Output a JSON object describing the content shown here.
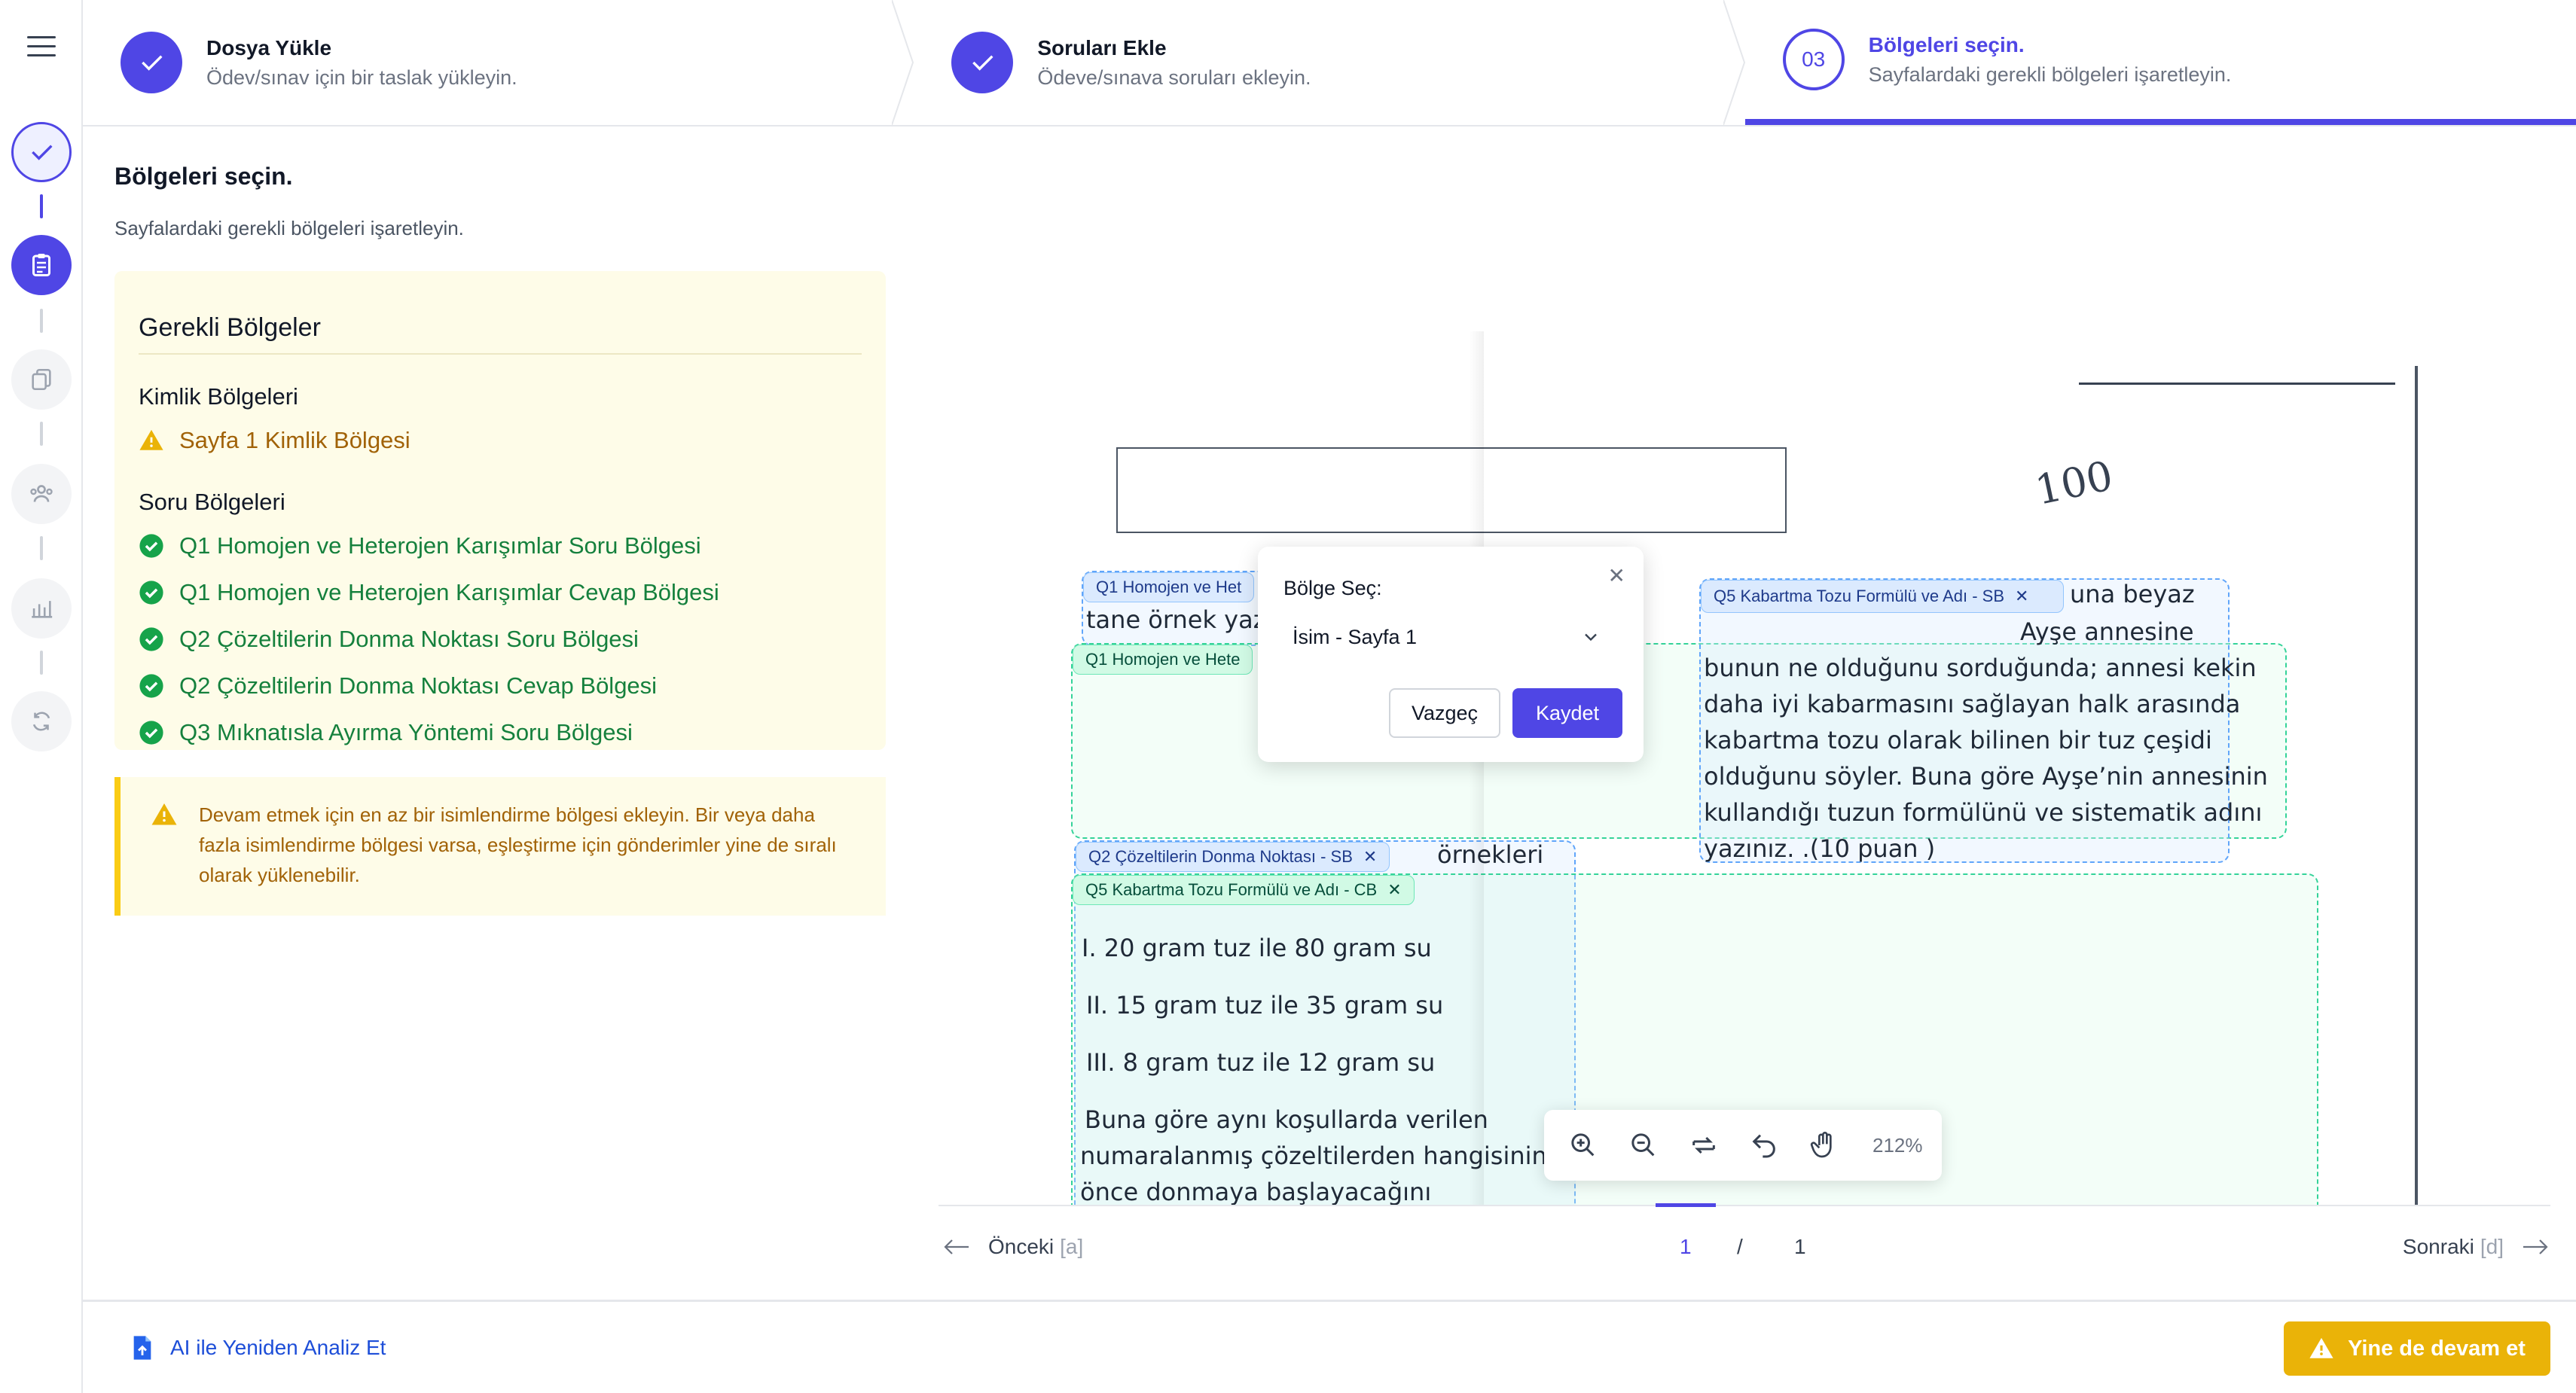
{
  "stepper": {
    "steps": [
      {
        "title": "Dosya Yükle",
        "desc": "Ödev/sınav için bir taslak yükleyin."
      },
      {
        "title": "Soruları Ekle",
        "desc": "Ödeve/sınava soruları ekleyin."
      },
      {
        "number": "03",
        "title": "Bölgeleri seçin.",
        "desc": "Sayfalardaki gerekli bölgeleri işaretleyin."
      }
    ]
  },
  "page": {
    "title": "Bölgeleri seçin.",
    "subtitle": "Sayfalardaki gerekli bölgeleri işaretleyin."
  },
  "regions": {
    "heading": "Gerekli Bölgeler",
    "identity_heading": "Kimlik Bölgeleri",
    "identity_items": [
      "Sayfa 1 Kimlik Bölgesi"
    ],
    "question_heading": "Soru Bölgeleri",
    "question_items": [
      "Q1 Homojen ve Heterojen Karışımlar Soru Bölgesi",
      "Q1 Homojen ve Heterojen Karışımlar Cevap Bölgesi",
      "Q2 Çözeltilerin Donma Noktası Soru Bölgesi",
      "Q2 Çözeltilerin Donma Noktası Cevap Bölgesi",
      "Q3 Mıknatısla Ayırma Yöntemi Soru Bölgesi"
    ]
  },
  "notice": {
    "text": "Devam etmek için en az bir isimlendirme bölgesi ekleyin. Bir veya daha fazla isimlendirme bölgesi varsa, eşleştirme için gönderimler yine de sıralı olarak yüklenebilir."
  },
  "doc": {
    "tags": {
      "q1_sb": "Q1 Homojen ve Het",
      "q1_cb": "Q1 Homojen ve Hete",
      "q5_sb": "Q5 Kabartma Tozu Formülü ve Adı - SB",
      "q2_sb": "Q2 Çözeltilerin Donma Noktası - SB",
      "q5_cb": "Q5 Kabartma Tozu Formülü ve Adı - CB"
    },
    "lines": {
      "l1": "tane örnek yazı",
      "r1": "una beyaz",
      "r2": "Ayşe annesine",
      "r3": "bunun ne olduğunu sorduğunda; annesi kekin",
      "r4": "daha iyi kabarmasını sağlayan halk arasında",
      "r5": "kabartma tozu olarak bilinen bir tuz çeşidi",
      "r6": "olduğunu söyler. Buna göre Ayşe’nin annesinin",
      "r7": "kullandığı tuzun formülünü ve sistematik adını",
      "r8": "yazınız. .(10 puan )",
      "m1": "örnekleri",
      "i": "I. 20 gram tuz ile 80 gram su",
      "ii": "II. 15 gram tuz ile 35 gram su",
      "iii": "III. 8 gram tuz ile 12 gram su",
      "b1": "Buna göre aynı koşullarda verilen",
      "b2": "numaralanmış çözeltilerden hangisinin da",
      "b3": "önce donmaya başlayacağını",
      "score": "100"
    }
  },
  "popup": {
    "label": "Bölge Seç:",
    "selected": "İsim - Sayfa 1",
    "cancel": "Vazgeç",
    "save": "Kaydet"
  },
  "toolbar": {
    "zoom": "212%"
  },
  "pager": {
    "prev": "Önceki",
    "prev_hint": "[a]",
    "next": "Sonraki",
    "next_hint": "[d]",
    "current": "1",
    "sep": "/",
    "total": "1"
  },
  "footer": {
    "ai_link": "AI ile Yeniden Analiz Et",
    "continue": "Yine de devam et"
  },
  "colors": {
    "accent": "#4f46e5",
    "warning": "#eab308",
    "success": "#16a34a",
    "panel_bg": "#fefce8"
  }
}
